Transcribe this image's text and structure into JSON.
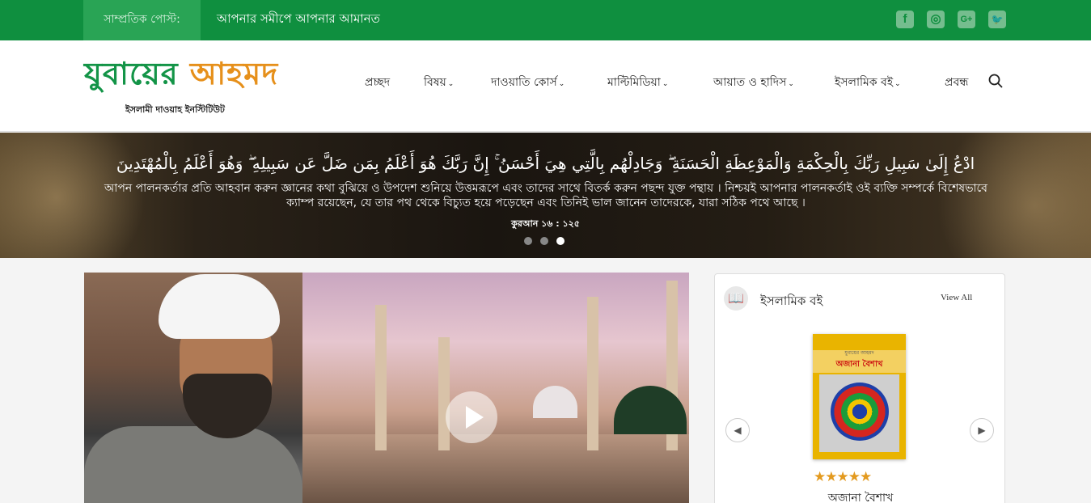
{
  "topbar": {
    "recent_label": "সাম্প্রতিক পোস্ট:",
    "recent_title": "আপনার সমীপে আপনার আমানত",
    "social": [
      {
        "icon": "facebook-icon",
        "glyph": "f"
      },
      {
        "icon": "instagram-icon",
        "glyph": "◎"
      },
      {
        "icon": "google-plus-icon",
        "glyph": "G+"
      },
      {
        "icon": "twitter-icon",
        "glyph": "🐦"
      }
    ]
  },
  "header": {
    "logo_part1": "যুবায়ের",
    "logo_part2": "আহমদ",
    "tagline": "ইসলামী দাওয়াহ ইনস্টিটিউট",
    "nav": [
      {
        "label": "প্রচ্ছদ",
        "has_dropdown": false
      },
      {
        "label": "বিষয়",
        "has_dropdown": true
      },
      {
        "label": "দাওয়াতি কোর্স",
        "has_dropdown": true
      },
      {
        "label": "মাল্টিমিডিয়া",
        "has_dropdown": true
      },
      {
        "label": "আয়াত ও হাদিস",
        "has_dropdown": true
      },
      {
        "label": "ইসলামিক বই",
        "has_dropdown": true
      },
      {
        "label": "প্রবন্ধ",
        "has_dropdown": false
      }
    ],
    "chevron": "⌄"
  },
  "banner": {
    "arabic": "ادْعُ إِلَىٰ سَبِيلِ رَبِّكَ بِالْحِكْمَةِ وَالْمَوْعِظَةِ الْحَسَنَةِ ۖ وَجَادِلْهُم بِالَّتِي هِيَ أَحْسَنُ ۚ إِنَّ رَبَّكَ هُوَ أَعْلَمُ بِمَن ضَلَّ عَن سَبِيلِهِ ۖ وَهُوَ أَعْلَمُ بِالْمُهْتَدِينَ",
    "translation": "আপন পালনকর্তার প্রতি আহবান করুন জ্ঞানের কথা বুঝিয়ে ও উপদেশ শুনিয়ে উত্তমরূপে এবং তাদের সাথে বিতর্ক করুন পছন্দ যুক্ত পন্থায় । নিশ্চয়ই আপনার পালনকর্তাই ওই ব্যক্তি সম্পর্কে বিশেষভাবে ক্যাম্প রয়েছেন, যে তার পথ থেকে বিচ্যুত হয়ে পড়েছেন এবং তিনিই ভাল জানেন তাদেরকে, যারা সঠিক পথে আছে ।",
    "reference": "কুরআন ১৬ : ১২৫",
    "slides": 3,
    "active_slide": 3
  },
  "book_panel": {
    "title": "ইসলামিক বই",
    "view_all": "View All",
    "book_icon": "book-icon",
    "prev_glyph": "◀",
    "next_glyph": "▶",
    "cover_top_text": "যুবায়ের আহমদ",
    "cover_title": "অজানা বৈশাখ",
    "rating": 5,
    "stars": "★★★★★",
    "book_name": "অজানা বৈশাখ"
  },
  "colors": {
    "brand_green": "#0f8f3f",
    "logo_orange": "#e6901b",
    "star": "#e39a1f"
  }
}
